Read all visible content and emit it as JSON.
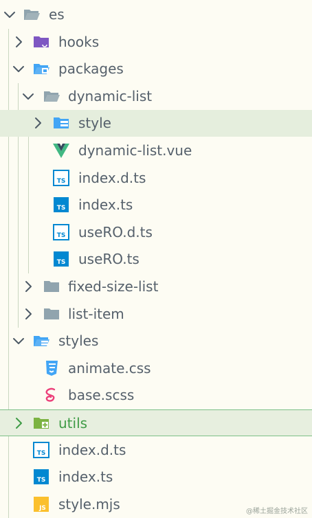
{
  "explorer": {
    "items": [
      {
        "label": "es",
        "depth": 0,
        "expanded": true,
        "icon": "folder-open-icon"
      },
      {
        "label": "hooks",
        "depth": 1,
        "expanded": false,
        "icon": "folder-purple-icon"
      },
      {
        "label": "packages",
        "depth": 1,
        "expanded": true,
        "icon": "folder-packages-icon"
      },
      {
        "label": "dynamic-list",
        "depth": 2,
        "expanded": true,
        "icon": "folder-open-icon"
      },
      {
        "label": "style",
        "depth": 3,
        "expanded": false,
        "icon": "folder-style-icon",
        "highlighted": true
      },
      {
        "label": "dynamic-list.vue",
        "depth": 3,
        "icon": "vue-file-icon"
      },
      {
        "label": "index.d.ts",
        "depth": 3,
        "icon": "ts-declaration-icon"
      },
      {
        "label": "index.ts",
        "depth": 3,
        "icon": "ts-file-icon"
      },
      {
        "label": "useRO.d.ts",
        "depth": 3,
        "icon": "ts-declaration-icon"
      },
      {
        "label": "useRO.ts",
        "depth": 3,
        "icon": "ts-file-icon"
      },
      {
        "label": "fixed-size-list",
        "depth": 2,
        "expanded": false,
        "icon": "folder-icon"
      },
      {
        "label": "list-item",
        "depth": 2,
        "expanded": false,
        "icon": "folder-icon"
      },
      {
        "label": "styles",
        "depth": 1,
        "expanded": true,
        "icon": "folder-styles-icon"
      },
      {
        "label": "animate.css",
        "depth": 2,
        "icon": "css-file-icon"
      },
      {
        "label": "base.scss",
        "depth": 2,
        "icon": "sass-file-icon"
      },
      {
        "label": "utils",
        "depth": 1,
        "expanded": false,
        "icon": "folder-utils-icon",
        "selected": true
      },
      {
        "label": "index.d.ts",
        "depth": 1,
        "icon": "ts-declaration-icon"
      },
      {
        "label": "index.ts",
        "depth": 1,
        "icon": "ts-file-icon"
      },
      {
        "label": "style.mjs",
        "depth": 1,
        "icon": "js-file-icon"
      }
    ]
  },
  "colors": {
    "background": "#fdfcf3",
    "text": "#55606b",
    "selected_text": "#3f9b46",
    "highlight": "#e5eedd",
    "folder_grey": "#90a4ae",
    "folder_purple": "#7e57c2",
    "folder_blue": "#42a5f5",
    "folder_green": "#7cb342",
    "ts_blue": "#0288d1",
    "vue_green": "#41b883",
    "vue_dark": "#35495e",
    "css_blue": "#42a5f5",
    "sass_pink": "#ec407a",
    "js_yellow": "#fbc02d"
  },
  "watermark": "@稀土掘金技术社区"
}
